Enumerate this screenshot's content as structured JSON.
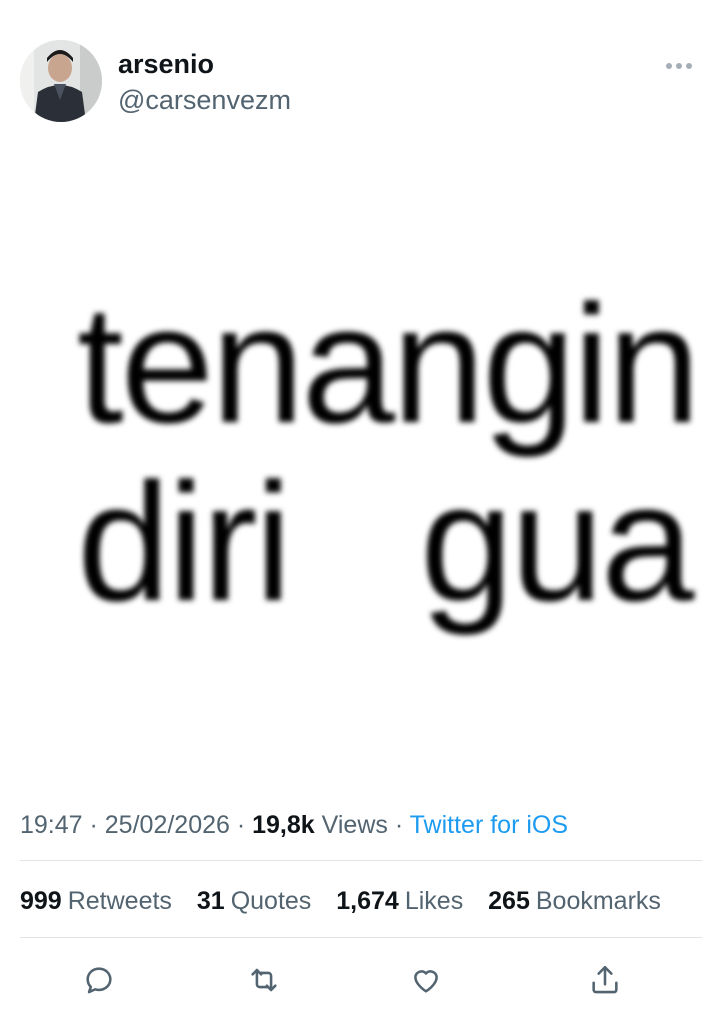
{
  "tweet": {
    "display_name": "arsenio",
    "handle": "@carsenvezm",
    "media_text": {
      "line1": "tenangin",
      "line2": "diri   gua"
    },
    "meta": {
      "time": "19:47",
      "date": "25/02/2026",
      "views_count": "19,8k",
      "views_label": "Views",
      "source": "Twitter for iOS",
      "separator": " · "
    },
    "stats": [
      {
        "count": "999",
        "label": "Retweets"
      },
      {
        "count": "31",
        "label": "Quotes"
      },
      {
        "count": "1,674",
        "label": "Likes"
      },
      {
        "count": "265",
        "label": "Bookmarks"
      }
    ]
  },
  "actions": [
    "reply-icon",
    "retweet-icon",
    "like-icon",
    "share-icon"
  ],
  "colors": {
    "text": "#0f1419",
    "secondary": "#536471",
    "accent": "#1d9bf0",
    "divider": "#dfe3e6"
  }
}
